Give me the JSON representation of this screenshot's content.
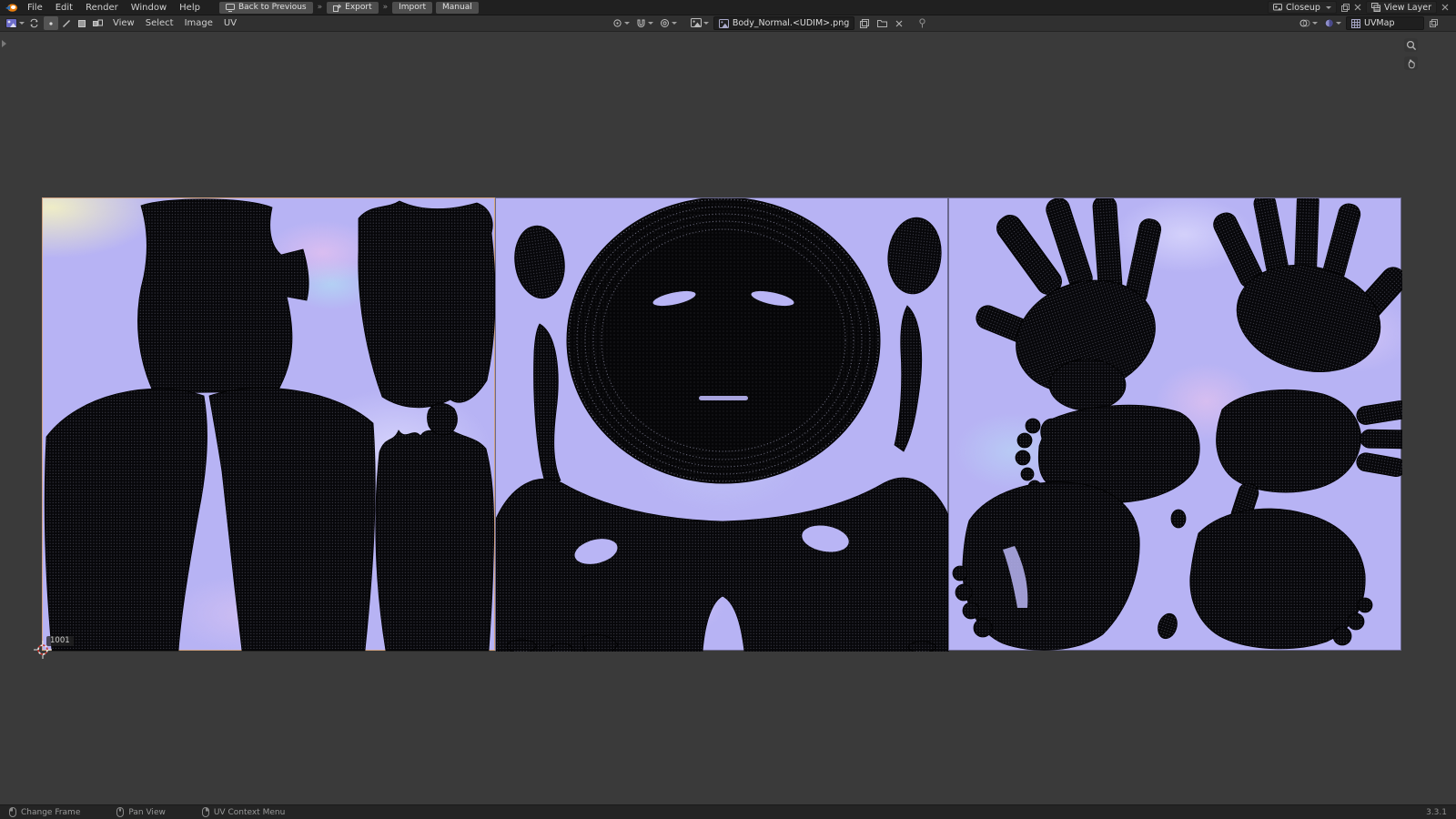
{
  "topbar": {
    "menus": [
      "File",
      "Edit",
      "Render",
      "Window",
      "Help"
    ],
    "ws": {
      "back_label": "Back to Previous",
      "export_label": "Export",
      "import_label": "Import",
      "manual_label": "Manual",
      "sep": "»"
    },
    "scene_name": "Closeup",
    "view_layer": "View Layer"
  },
  "editor": {
    "menus": [
      "View",
      "Select",
      "Image",
      "UV"
    ],
    "image_name": "Body_Normal.<UDIM>.png",
    "uvmap_name": "UVMap"
  },
  "canvas": {
    "udim_label": "1001"
  },
  "statusbar": {
    "items": [
      {
        "label": "Change Frame"
      },
      {
        "label": "Pan View"
      },
      {
        "label": "UV Context Menu"
      }
    ],
    "version": "3.3.1"
  },
  "colors": {
    "topbar_bg": "#202020",
    "header_bg": "#303030",
    "canvas_bg": "#3a3a3a",
    "tile_base": "#b7b3f4",
    "active_tile_border": "#d6a06e",
    "island_fill": "#07070a"
  },
  "icons": {
    "note": "icon semantics carried via data-name attributes: blender-logo-icon, screen-icon, scene-icon, view-layer-icon, editor-type-icon, uv-sync-icon, vertex-select-icon, edge-select-icon, face-select-icon, island-select-icon, pivot-icon, snap-magnet-icon, proportional-edit-icon, browse-image-icon, image-icon, new-image-icon, open-folder-icon, unlink-icon, pin-icon, overlay-icon, channels-icon, uv-grid-icon, zoom-icon, pan-hand-icon, mouse-left-icon, mouse-middle-icon, mouse-right-icon, cursor-2d"
  }
}
